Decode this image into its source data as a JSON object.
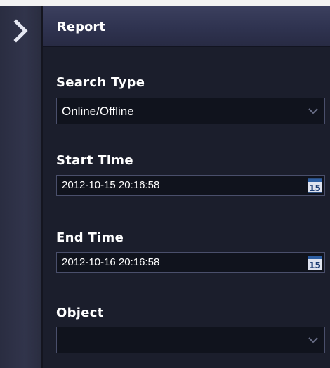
{
  "header": {
    "title": "Report"
  },
  "form": {
    "search_type": {
      "label": "Search Type",
      "value": "Online/Offline"
    },
    "start_time": {
      "label": "Start Time",
      "value": "2012-10-15 20:16:58",
      "calendar_icon_text": "15"
    },
    "end_time": {
      "label": "End Time",
      "value": "2012-10-16 20:16:58",
      "calendar_icon_text": "15"
    },
    "object": {
      "label": "Object",
      "value": ""
    }
  },
  "icons": {
    "expand": "chevron-right-icon",
    "dropdown": "chevron-down-icon",
    "calendar": "calendar-icon"
  },
  "colors": {
    "panel_bg": "#1b1e2c",
    "header_bg": "#2f3350",
    "field_bg": "#10131d",
    "field_border": "#4a4f6b",
    "text": "#ffffff"
  }
}
